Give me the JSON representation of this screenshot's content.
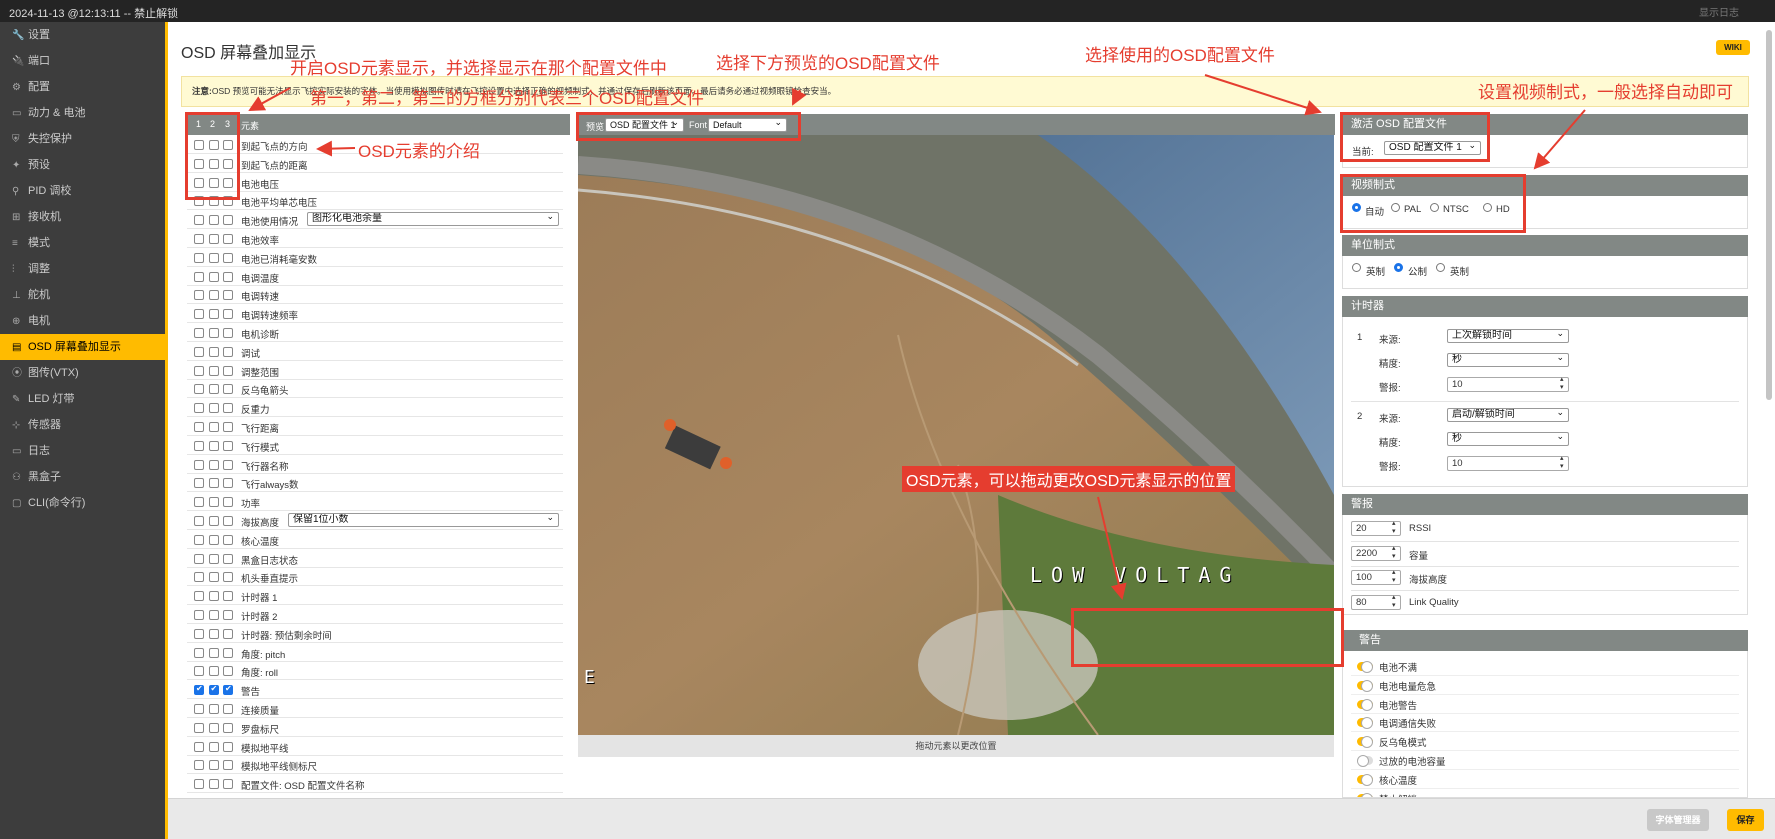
{
  "topbar": {
    "status": "2024-11-13 @12:13:11 -- 禁止解锁",
    "right": "显示日志"
  },
  "sidebar": {
    "items": [
      {
        "label": "设置",
        "icon": "wrench-icon",
        "glyph": "🔧"
      },
      {
        "label": "端口",
        "icon": "plug-icon",
        "glyph": "🔌"
      },
      {
        "label": "配置",
        "icon": "gear-icon",
        "glyph": "⚙"
      },
      {
        "label": "动力 & 电池",
        "icon": "battery-icon",
        "glyph": "▭"
      },
      {
        "label": "失控保护",
        "icon": "shield-icon",
        "glyph": "⛨"
      },
      {
        "label": "预设",
        "icon": "magic-wand-icon",
        "glyph": "✦"
      },
      {
        "label": "PID 调校",
        "icon": "tuning-icon",
        "glyph": "⚲"
      },
      {
        "label": "接收机",
        "icon": "receiver-icon",
        "glyph": "⊞"
      },
      {
        "label": "模式",
        "icon": "switch-icon",
        "glyph": "≡"
      },
      {
        "label": "调整",
        "icon": "sliders-icon",
        "glyph": "⫶"
      },
      {
        "label": "舵机",
        "icon": "servo-icon",
        "glyph": "⊥"
      },
      {
        "label": "电机",
        "icon": "motor-icon",
        "glyph": "⊕"
      },
      {
        "label": "OSD 屏幕叠加显示",
        "icon": "osd-icon",
        "glyph": "▤"
      },
      {
        "label": "图传(VTX)",
        "icon": "antenna-icon",
        "glyph": "⦿"
      },
      {
        "label": "LED 灯带",
        "icon": "led-icon",
        "glyph": "✎"
      },
      {
        "label": "传感器",
        "icon": "sensor-icon",
        "glyph": "⊹"
      },
      {
        "label": "日志",
        "icon": "log-icon",
        "glyph": "▭"
      },
      {
        "label": "黑盒子",
        "icon": "blackbox-icon",
        "glyph": "⚇"
      },
      {
        "label": "CLI(命令行)",
        "icon": "terminal-icon",
        "glyph": "▢"
      }
    ]
  },
  "page": {
    "title": "OSD 屏幕叠加显示",
    "wiki": "WIKI"
  },
  "note": {
    "bold": "注意:",
    "text": "OSD 预览可能无法显示飞控实际安装的字体。当使用模拟图传时请在飞控设置中选择正确的视频制式，并通过保存后刷新该页面。最后请务必通过视频眼镜检查安当。"
  },
  "elements": {
    "header": {
      "profiles": [
        "1",
        "2",
        "3"
      ],
      "title": "元素"
    },
    "rows": [
      {
        "label": "到起飞点的方向",
        "checks": [
          false,
          false,
          false
        ]
      },
      {
        "label": "到起飞点的距离",
        "checks": [
          false,
          false,
          false
        ]
      },
      {
        "label": "电池电压",
        "checks": [
          false,
          false,
          false
        ]
      },
      {
        "label": "电池平均单芯电压",
        "checks": [
          false,
          false,
          false
        ]
      },
      {
        "label": "电池使用情况",
        "checks": [
          false,
          false,
          false
        ],
        "select": "图形化电池余量"
      },
      {
        "label": "电池效率",
        "checks": [
          false,
          false,
          false
        ]
      },
      {
        "label": "电池已消耗毫安数",
        "checks": [
          false,
          false,
          false
        ]
      },
      {
        "label": "电调温度",
        "checks": [
          false,
          false,
          false
        ]
      },
      {
        "label": "电调转速",
        "checks": [
          false,
          false,
          false
        ]
      },
      {
        "label": "电调转速频率",
        "checks": [
          false,
          false,
          false
        ]
      },
      {
        "label": "电机诊断",
        "checks": [
          false,
          false,
          false
        ]
      },
      {
        "label": "调试",
        "checks": [
          false,
          false,
          false
        ]
      },
      {
        "label": "调整范围",
        "checks": [
          false,
          false,
          false
        ]
      },
      {
        "label": "反乌龟箭头",
        "checks": [
          false,
          false,
          false
        ]
      },
      {
        "label": "反重力",
        "checks": [
          false,
          false,
          false
        ]
      },
      {
        "label": "飞行距离",
        "checks": [
          false,
          false,
          false
        ]
      },
      {
        "label": "飞行模式",
        "checks": [
          false,
          false,
          false
        ]
      },
      {
        "label": "飞行器名称",
        "checks": [
          false,
          false,
          false
        ]
      },
      {
        "label": "飞行always数",
        "checks": [
          false,
          false,
          false
        ]
      },
      {
        "label": "功率",
        "checks": [
          false,
          false,
          false
        ]
      },
      {
        "label": "海拔高度",
        "checks": [
          false,
          false,
          false
        ],
        "select": "保留1位小数"
      },
      {
        "label": "核心温度",
        "checks": [
          false,
          false,
          false
        ]
      },
      {
        "label": "黑盒日志状态",
        "checks": [
          false,
          false,
          false
        ]
      },
      {
        "label": "机头垂直提示",
        "checks": [
          false,
          false,
          false
        ]
      },
      {
        "label": "计时器 1",
        "checks": [
          false,
          false,
          false
        ]
      },
      {
        "label": "计时器 2",
        "checks": [
          false,
          false,
          false
        ]
      },
      {
        "label": "计时器: 预估剩余时间",
        "checks": [
          false,
          false,
          false
        ]
      },
      {
        "label": "角度: pitch",
        "checks": [
          false,
          false,
          false
        ]
      },
      {
        "label": "角度: roll",
        "checks": [
          false,
          false,
          false
        ]
      },
      {
        "label": "警告",
        "checks": [
          true,
          true,
          true
        ]
      },
      {
        "label": "连接质量",
        "checks": [
          false,
          false,
          false
        ]
      },
      {
        "label": "罗盘标尺",
        "checks": [
          false,
          false,
          false
        ]
      },
      {
        "label": "模拟地平线",
        "checks": [
          false,
          false,
          false
        ]
      },
      {
        "label": "模拟地平线侧标尺",
        "checks": [
          false,
          false,
          false
        ]
      },
      {
        "label": "配置文件: OSD 配置文件名称",
        "checks": [
          false,
          false,
          false
        ]
      }
    ]
  },
  "preview": {
    "label": "预览",
    "profile": "OSD 配置文件 1",
    "font_label": "Font",
    "font": "Default",
    "footer": "拖动元素以更改位置",
    "osd_warning": "LOW VOLTAG",
    "osd_left": "E"
  },
  "active_profile": {
    "title": "激活 OSD 配置文件",
    "current_label": "当前:",
    "current": "OSD 配置文件 1"
  },
  "video_format": {
    "title": "视频制式",
    "options": [
      {
        "label": "自动",
        "checked": true
      },
      {
        "label": "PAL",
        "checked": false
      },
      {
        "label": "NTSC",
        "checked": false
      },
      {
        "label": "HD",
        "checked": false
      }
    ]
  },
  "units": {
    "title": "单位制式",
    "options": [
      {
        "label": "英制",
        "checked": false
      },
      {
        "label": "公制",
        "checked": true
      },
      {
        "label": "英制",
        "checked": false
      }
    ]
  },
  "timers": {
    "title": "计时器",
    "items": [
      {
        "index": "1",
        "source_label": "来源:",
        "source": "上次解锁时间",
        "precision_label": "精度:",
        "precision": "秒",
        "alarm_label": "警报:",
        "alarm": "10"
      },
      {
        "index": "2",
        "source_label": "来源:",
        "source": "启动/解锁时间",
        "precision_label": "精度:",
        "precision": "秒",
        "alarm_label": "警报:",
        "alarm": "10"
      }
    ]
  },
  "alarms": {
    "title": "警报",
    "items": [
      {
        "value": "20",
        "label": "RSSI"
      },
      {
        "value": "2200",
        "label": "容量"
      },
      {
        "value": "100",
        "label": "海拔高度"
      },
      {
        "value": "80",
        "label": "Link Quality"
      }
    ]
  },
  "warnings": {
    "title": "警告",
    "items": [
      {
        "label": "电池不满",
        "on": true
      },
      {
        "label": "电池电量危急",
        "on": true
      },
      {
        "label": "电池警告",
        "on": true
      },
      {
        "label": "电调通信失败",
        "on": true
      },
      {
        "label": "反乌龟模式",
        "on": true
      },
      {
        "label": "过放的电池容量",
        "on": false
      },
      {
        "label": "核心温度",
        "on": true
      },
      {
        "label": "禁止解锁",
        "on": true
      }
    ]
  },
  "buttons": {
    "font_manager": "字体管理器",
    "save": "保存"
  },
  "annotations": {
    "a1": "开启OSD元素显示，并选择显示在那个配置文件中",
    "a2": "第一，第二，第三的方框分别代表三个OSD配置文件",
    "a3": "选择下方预览的OSD配置文件",
    "a4": "选择使用的OSD配置文件",
    "a5": "设置视频制式，一般选择自动即可",
    "a6": "OSD元素的介绍",
    "a7": "OSD元素，可以拖动更改OSD元素显示的位置"
  },
  "colors": {
    "accent": "#ffbb00",
    "annotation": "#e53d2f",
    "checkbox": "#1a73e8"
  }
}
